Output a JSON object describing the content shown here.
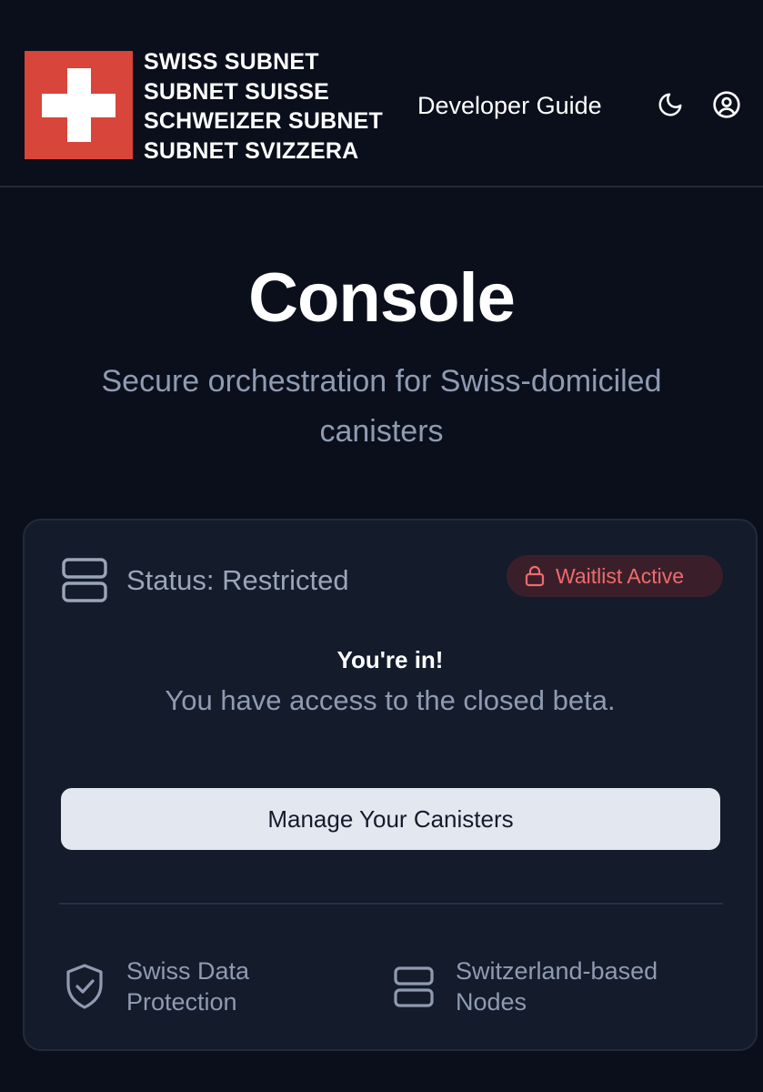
{
  "header": {
    "brand_lines": [
      "SWISS SUBNET",
      "SUBNET SUISSE",
      "SCHWEIZER SUBNET",
      "SUBNET SVIZZERA"
    ],
    "nav_link": "Developer Guide",
    "theme_icon": "moon-icon",
    "account_icon": "user-circle-icon",
    "flag_color": "#d8453a"
  },
  "hero": {
    "title": "Console",
    "subtitle": "Secure orchestration for Swiss-domiciled canisters"
  },
  "card": {
    "status_icon": "server-icon",
    "status_text": "Status: Restricted",
    "badge_icon": "lock-icon",
    "badge_text": "Waitlist Active",
    "badge_color": "#ee6b6b",
    "headline": "You're in!",
    "message": "You have access to the closed beta.",
    "button_label": "Manage Your Canisters",
    "features": [
      {
        "icon": "shield-check-icon",
        "label_line1": "Swiss Data",
        "label_line2": "Protection"
      },
      {
        "icon": "server-icon",
        "label_line1": "Switzerland-based",
        "label_line2": "Nodes"
      }
    ]
  },
  "colors": {
    "background": "#0b0f1c",
    "card_background": "#141b2b",
    "muted_text": "#8f9bb1",
    "button_background": "#e3e8f0"
  }
}
